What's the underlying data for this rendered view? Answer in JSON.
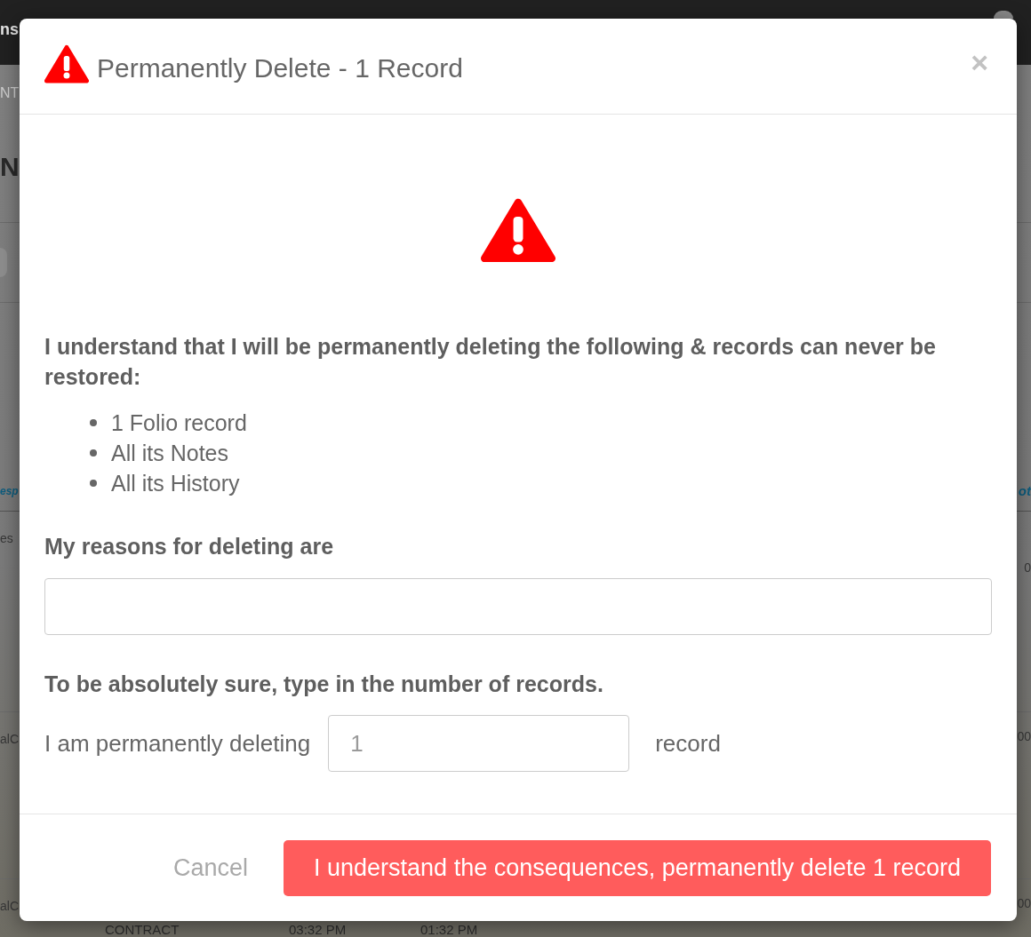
{
  "background": {
    "top_bar": {
      "title": "ns"
    },
    "breadcrumb": "NT",
    "heading": "N",
    "table": {
      "header": {
        "column_1": "esp",
        "last_column": "ot"
      },
      "rows": [
        {
          "column_1": "es",
          "last_column": "0"
        },
        {
          "column_1": "alC",
          "last_column": "00"
        },
        {
          "column_1": "alC",
          "last_column": "00",
          "details": [
            "CONTRACT",
            "03:32 PM",
            "01:32 PM"
          ]
        }
      ]
    }
  },
  "dialog": {
    "title": "Permanently Delete - 1 Record",
    "close": "×",
    "warning": "I understand that I will be permanently deleting the following & records can never be restored:",
    "warning_list": [
      "1 Folio record",
      "All its Notes",
      "All its History"
    ],
    "reasons": {
      "label": "My reasons for deleting are"
    },
    "confirm": {
      "instruction": "To be absolutely sure, type in the number of records.",
      "prefix": "I am permanently deleting",
      "placeholder": "1",
      "suffix": "record"
    },
    "buttons": [
      {
        "label": "Cancel",
        "kind": "link"
      },
      {
        "label": "I understand the consequences, permanently delete 1 record",
        "kind": "danger"
      }
    ]
  }
}
